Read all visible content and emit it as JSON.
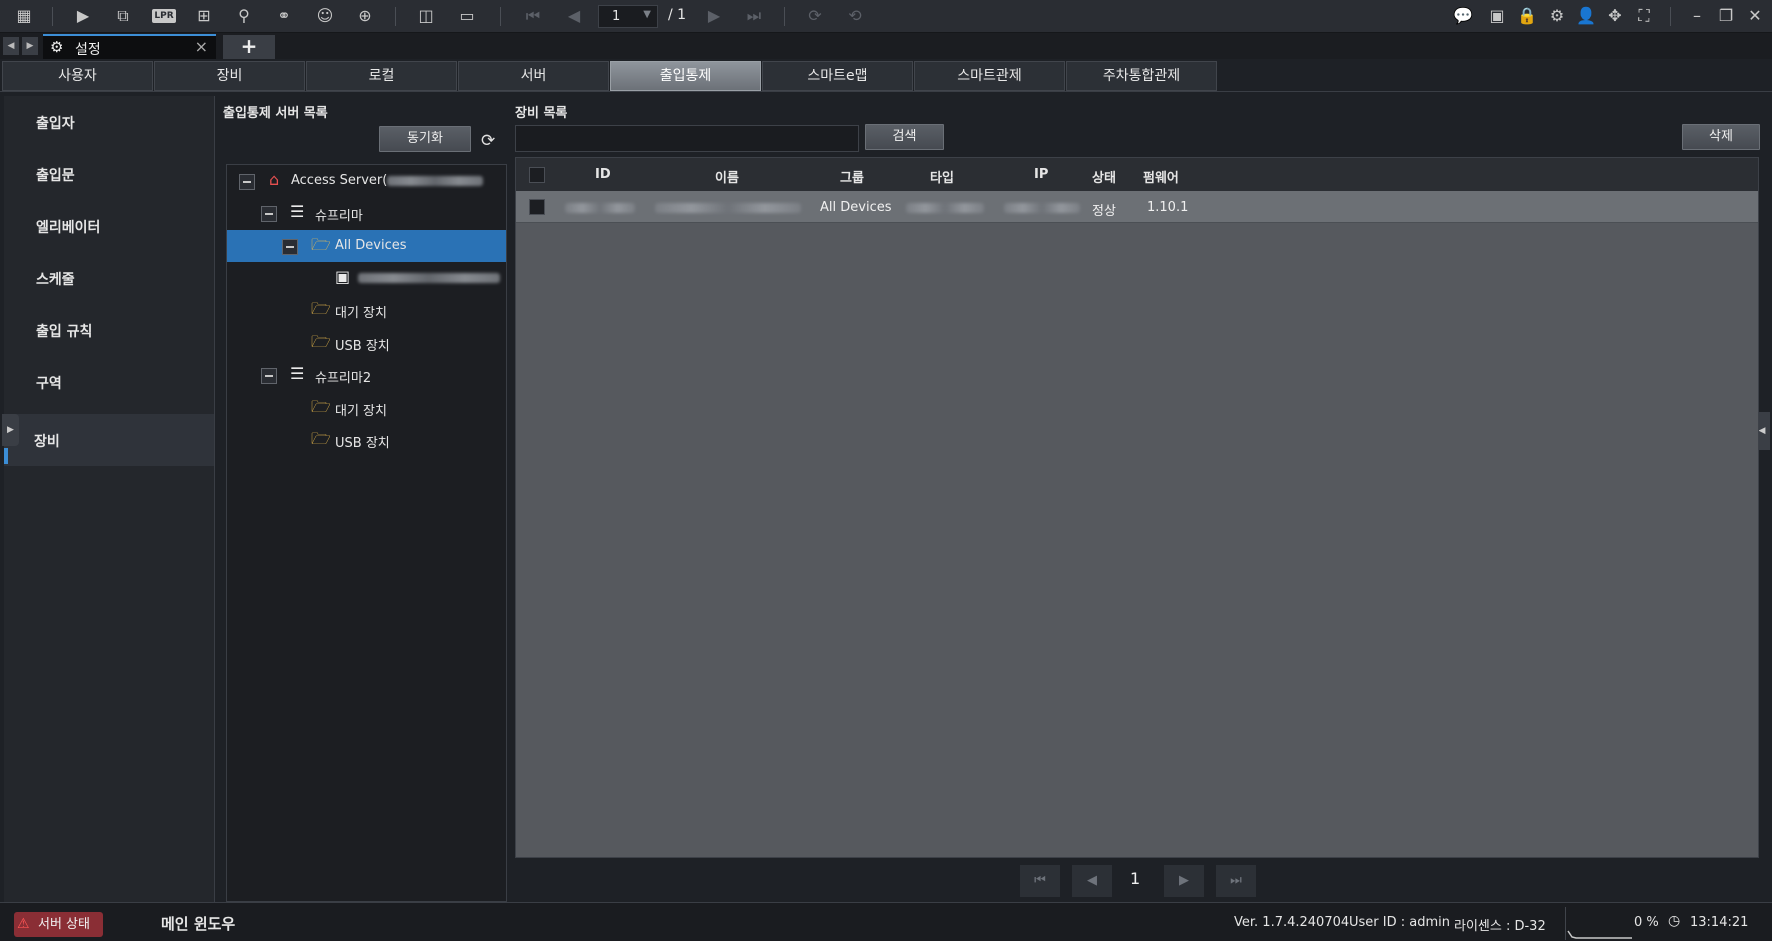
{
  "toolbar": {
    "icons": [
      "grid-menu-icon",
      "play-icon",
      "search-video-icon",
      "lpr-icon",
      "grid-search-icon",
      "person-search-icon",
      "bicycle-icon",
      "face-search-icon",
      "map-search-icon",
      "split-view-icon",
      "screen-add-icon",
      "first-page-icon",
      "prev-page-icon",
      "next-page-icon",
      "last-page-icon",
      "rotate-icon",
      "rotate-alt-icon",
      "chat-icon",
      "monitor-icon",
      "lock-icon",
      "gear-icon",
      "user-icon",
      "move-icon",
      "fullscreen-icon",
      "minimize-icon",
      "restore-icon",
      "close-icon"
    ],
    "lpr_label": "LPR",
    "page_current": "1",
    "page_total": "/ 1"
  },
  "tab": {
    "title": "설정",
    "add_label": "+"
  },
  "categories": [
    "사용자",
    "장비",
    "로컬",
    "서버",
    "출입통제",
    "스마트e맵",
    "스마트관제",
    "주차통합관제"
  ],
  "active_category": "출입통제",
  "leftnav": [
    "출입자",
    "출입문",
    "엘리베이터",
    "스케줄",
    "출입 규칙",
    "구역",
    "장비"
  ],
  "leftnav_selected": "장비",
  "server_panel": {
    "title": "출입통제 서버 목록",
    "sync_label": "동기화",
    "tree": [
      {
        "label": "Access Server(",
        "masked": true
      },
      {
        "label": "슈프리마"
      },
      {
        "label": "All Devices",
        "selected": true
      },
      {
        "label": "",
        "masked": true
      },
      {
        "label": "대기 장치"
      },
      {
        "label": "USB 장치"
      },
      {
        "label": "슈프리마2"
      },
      {
        "label": "대기 장치"
      },
      {
        "label": "USB 장치"
      }
    ]
  },
  "device_panel": {
    "title": "장비 목록",
    "search_label": "검색",
    "search_value": "",
    "delete_label": "삭제",
    "columns": [
      "ID",
      "이름",
      "그룹",
      "타입",
      "IP",
      "상태",
      "펌웨어"
    ],
    "rows": [
      {
        "id": "",
        "name": "",
        "group": "All Devices",
        "type": "",
        "ip": "",
        "status": "정상",
        "firmware": "1.10.1"
      }
    ],
    "page": "1"
  },
  "statusbar": {
    "server_status": "서버 상태",
    "main_window": "메인 윈도우",
    "version": "Ver. 1.7.4.240704",
    "user": "User ID : admin",
    "license": "라이센스 : D-32",
    "cpu": "0 %",
    "time": "13:14:21"
  },
  "colors": {
    "accent": "#3c8ed6",
    "selection": "#2a72b5",
    "active_tab": "#7d838a",
    "error": "#8a2e35"
  }
}
